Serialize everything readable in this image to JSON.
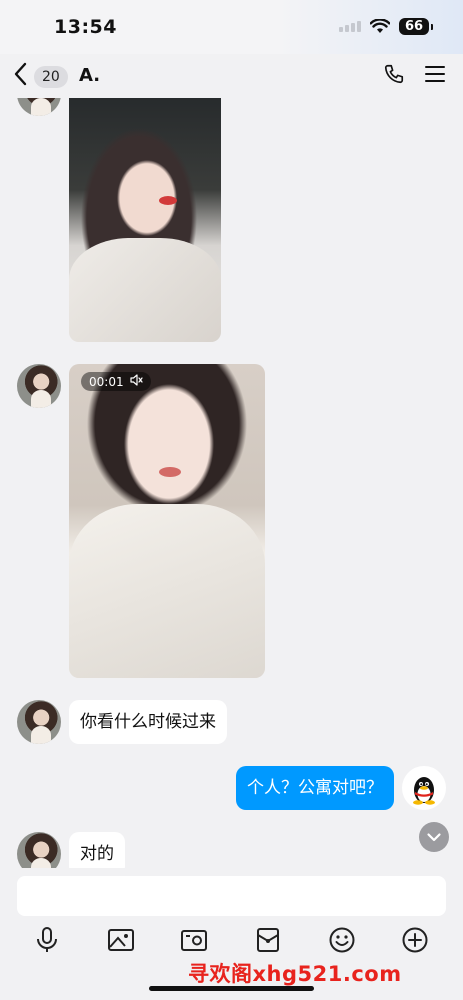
{
  "status_bar": {
    "time": "13:54",
    "battery": "66"
  },
  "nav": {
    "unread_count": "20",
    "title": "A."
  },
  "messages": {
    "video_duration": "00:01",
    "msg1": "你看什么时候过来",
    "msg2": "个人？公寓对吧？",
    "msg3": "对的"
  },
  "input": {
    "value": ""
  },
  "watermark": "寻欢阁xhg521.com",
  "colors": {
    "accent": "#0099ff",
    "background": "#f1f1f3",
    "watermark": "#e8231d"
  },
  "icons": [
    "back-icon",
    "phone-icon",
    "menu-icon",
    "mute-icon",
    "microphone-icon",
    "image-icon",
    "camera-icon",
    "red-packet-icon",
    "emoji-icon",
    "plus-icon",
    "chevron-down-icon"
  ]
}
